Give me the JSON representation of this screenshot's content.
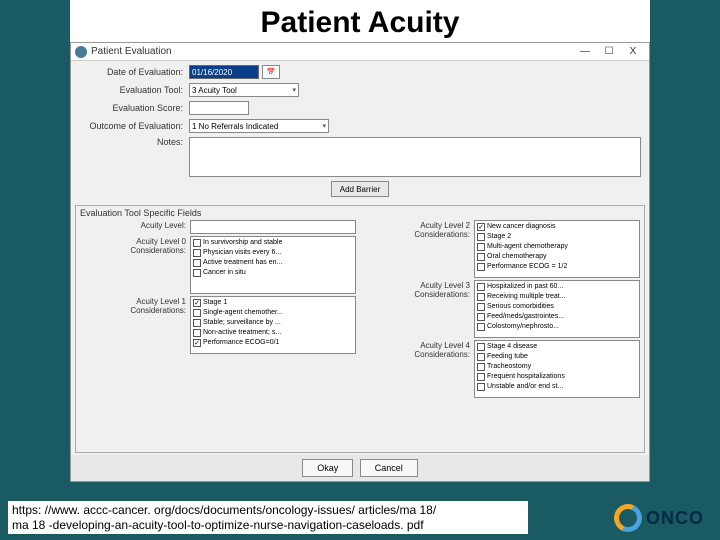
{
  "slide": {
    "title": "Patient Acuity"
  },
  "window": {
    "title": "Patient Evaluation",
    "min": "—",
    "max": "☐",
    "close": "X"
  },
  "form": {
    "date_label": "Date of Evaluation:",
    "date_value": "01/16/2020",
    "tool_label": "Evaluation Tool:",
    "tool_value": "3 Acuity Tool",
    "score_label": "Evaluation Score:",
    "outcome_label": "Outcome of Evaluation:",
    "outcome_value": "1 No Referrals Indicated",
    "notes_label": "Notes:",
    "add_btn": "Add Barrier"
  },
  "fieldset_legend": "Evaluation Tool Specific Fields",
  "acuity": {
    "level_label": "Acuity Level:",
    "l0_label": "Acuity Level 0 Considerations:",
    "l0_items": [
      {
        "t": "In survivorship and stable",
        "c": false
      },
      {
        "t": "Physician visits every 6...",
        "c": false
      },
      {
        "t": "Active treatment has en...",
        "c": false
      },
      {
        "t": "Cancer in situ",
        "c": false
      }
    ],
    "l1_label": "Acuity Level 1 Considerations:",
    "l1_items": [
      {
        "t": "Stage 1",
        "c": true
      },
      {
        "t": "Single-agent chemother...",
        "c": false
      },
      {
        "t": "Stable; surveillance by ...",
        "c": false
      },
      {
        "t": "Non-active treatment; s...",
        "c": false
      },
      {
        "t": "Performance ECOG=0/1",
        "c": true
      }
    ],
    "l2_label": "Acuity Level 2 Considerations:",
    "l2_items": [
      {
        "t": "New cancer diagnosis",
        "c": true
      },
      {
        "t": "Stage 2",
        "c": false
      },
      {
        "t": "Multi-agent chemotherapy",
        "c": false
      },
      {
        "t": "Oral chemotherapy",
        "c": false
      },
      {
        "t": "Performance ECOG = 1/2",
        "c": false
      }
    ],
    "l3_label": "Acuity Level 3 Considerations:",
    "l3_items": [
      {
        "t": "Hospitalized in past 60...",
        "c": false
      },
      {
        "t": "Receiving multiple treat...",
        "c": false
      },
      {
        "t": "Serious comorbidities",
        "c": false
      },
      {
        "t": "Feed/meds/gastrointes...",
        "c": false
      },
      {
        "t": "Colostomy/nephrosto...",
        "c": false
      }
    ],
    "l4_label": "Acuity Level 4 Considerations:",
    "l4_items": [
      {
        "t": "Stage 4 disease",
        "c": false
      },
      {
        "t": "Feeding tube",
        "c": false
      },
      {
        "t": "Tracheostomy",
        "c": false
      },
      {
        "t": "Frequent hospitalizations",
        "c": false
      },
      {
        "t": "Unstable and/or end st...",
        "c": false
      }
    ]
  },
  "buttons": {
    "ok": "Okay",
    "cancel": "Cancel"
  },
  "footer": {
    "url1": "https: //www. accc-cancer. org/docs/documents/oncology-issues/ articles/ma 18/",
    "url2": "ma 18 -developing-an-acuity-tool-to-optimize-nurse-navigation-caseloads. pdf"
  },
  "logo": {
    "text": "ONCO"
  }
}
